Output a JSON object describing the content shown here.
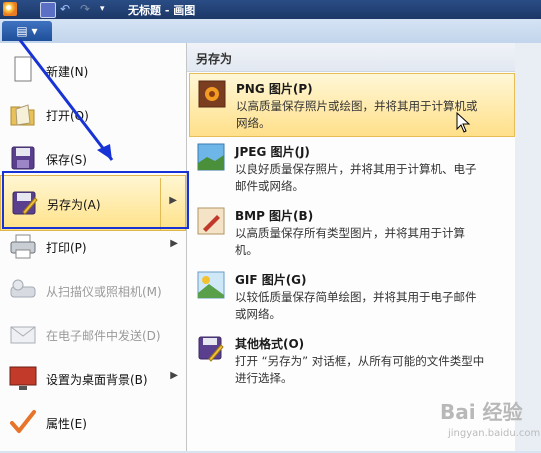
{
  "titlebar": {
    "title": "无标题 - 画图"
  },
  "quick_access": [
    "save-icon",
    "undo-icon",
    "redo-icon",
    "dropdown-icon"
  ],
  "menu_button": {
    "label": "▤ ▾"
  },
  "file_menu": [
    {
      "label": "新建(N)",
      "icon": "new-page-icon",
      "disabled": false,
      "submenu": false
    },
    {
      "label": "打开(O)",
      "icon": "open-folder-icon",
      "disabled": false,
      "submenu": false
    },
    {
      "label": "保存(S)",
      "icon": "save-icon",
      "disabled": false,
      "submenu": false
    },
    {
      "label": "另存为(A)",
      "icon": "save-as-icon",
      "disabled": false,
      "submenu": true,
      "highlighted": true
    },
    {
      "label": "打印(P)",
      "icon": "printer-icon",
      "disabled": false,
      "submenu": true
    },
    {
      "label": "从扫描仪或照相机(M)",
      "icon": "scanner-icon",
      "disabled": true,
      "submenu": false
    },
    {
      "label": "在电子邮件中发送(D)",
      "icon": "email-icon",
      "disabled": true,
      "submenu": false
    },
    {
      "label": "设置为桌面背景(B)",
      "icon": "desktop-icon",
      "disabled": false,
      "submenu": true
    },
    {
      "label": "属性(E)",
      "icon": "checkmark-icon",
      "disabled": false,
      "submenu": false
    }
  ],
  "save_as": {
    "header": "另存为",
    "items": [
      {
        "title": "PNG 图片(P)",
        "desc": "以高质量保存照片或绘图，并将其用于计算机或网络。",
        "icon": "png-image-icon"
      },
      {
        "title": "JPEG 图片(J)",
        "desc": "以良好质量保存照片，并将其用于计算机、电子邮件或网络。",
        "icon": "jpeg-image-icon"
      },
      {
        "title": "BMP 图片(B)",
        "desc": "以高质量保存所有类型图片，并将其用于计算机。",
        "icon": "bmp-image-icon"
      },
      {
        "title": "GIF 图片(G)",
        "desc": "以较低质量保存简单绘图，并将其用于电子邮件或网络。",
        "icon": "gif-image-icon"
      },
      {
        "title": "其他格式(O)",
        "desc": "打开 “另存为” 对话框，从所有可能的文件类型中进行选择。",
        "icon": "other-formats-icon"
      }
    ]
  },
  "watermark": {
    "text": "Bai 经验",
    "sub": "jingyan.baidu.com"
  },
  "colors": {
    "highlight": "#ffe289",
    "annotation": "#1733d6",
    "title_bg": "#1c3766"
  }
}
